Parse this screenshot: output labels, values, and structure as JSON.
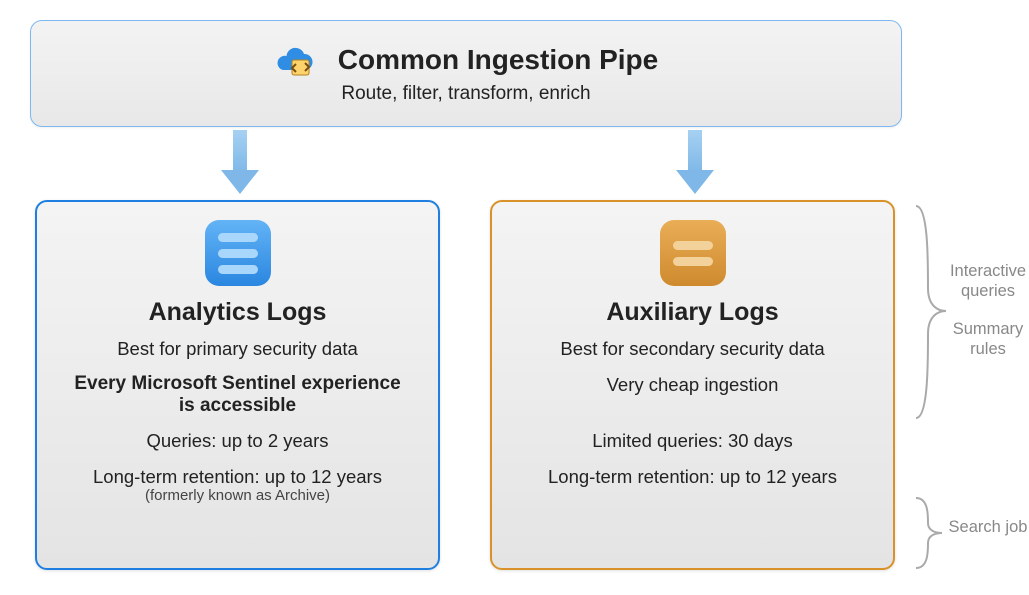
{
  "pipe": {
    "title": "Common Ingestion Pipe",
    "subtitle": "Route, filter, transform, enrich"
  },
  "analytics": {
    "title": "Analytics Logs",
    "best_for": "Best for primary security data",
    "highlight": "Every Microsoft Sentinel experience is accessible",
    "queries": "Queries: up to 2 years",
    "retention": "Long-term retention: up to 12 years",
    "retention_note": "(formerly known as Archive)"
  },
  "auxiliary": {
    "title": "Auxiliary Logs",
    "best_for": "Best for secondary security data",
    "highlight": "Very cheap ingestion",
    "queries": "Limited queries: 30 days",
    "retention": "Long-term retention: up to 12 years"
  },
  "annotations": {
    "interactive": "Interactive queries",
    "summary": "Summary rules",
    "search": "Search job"
  }
}
